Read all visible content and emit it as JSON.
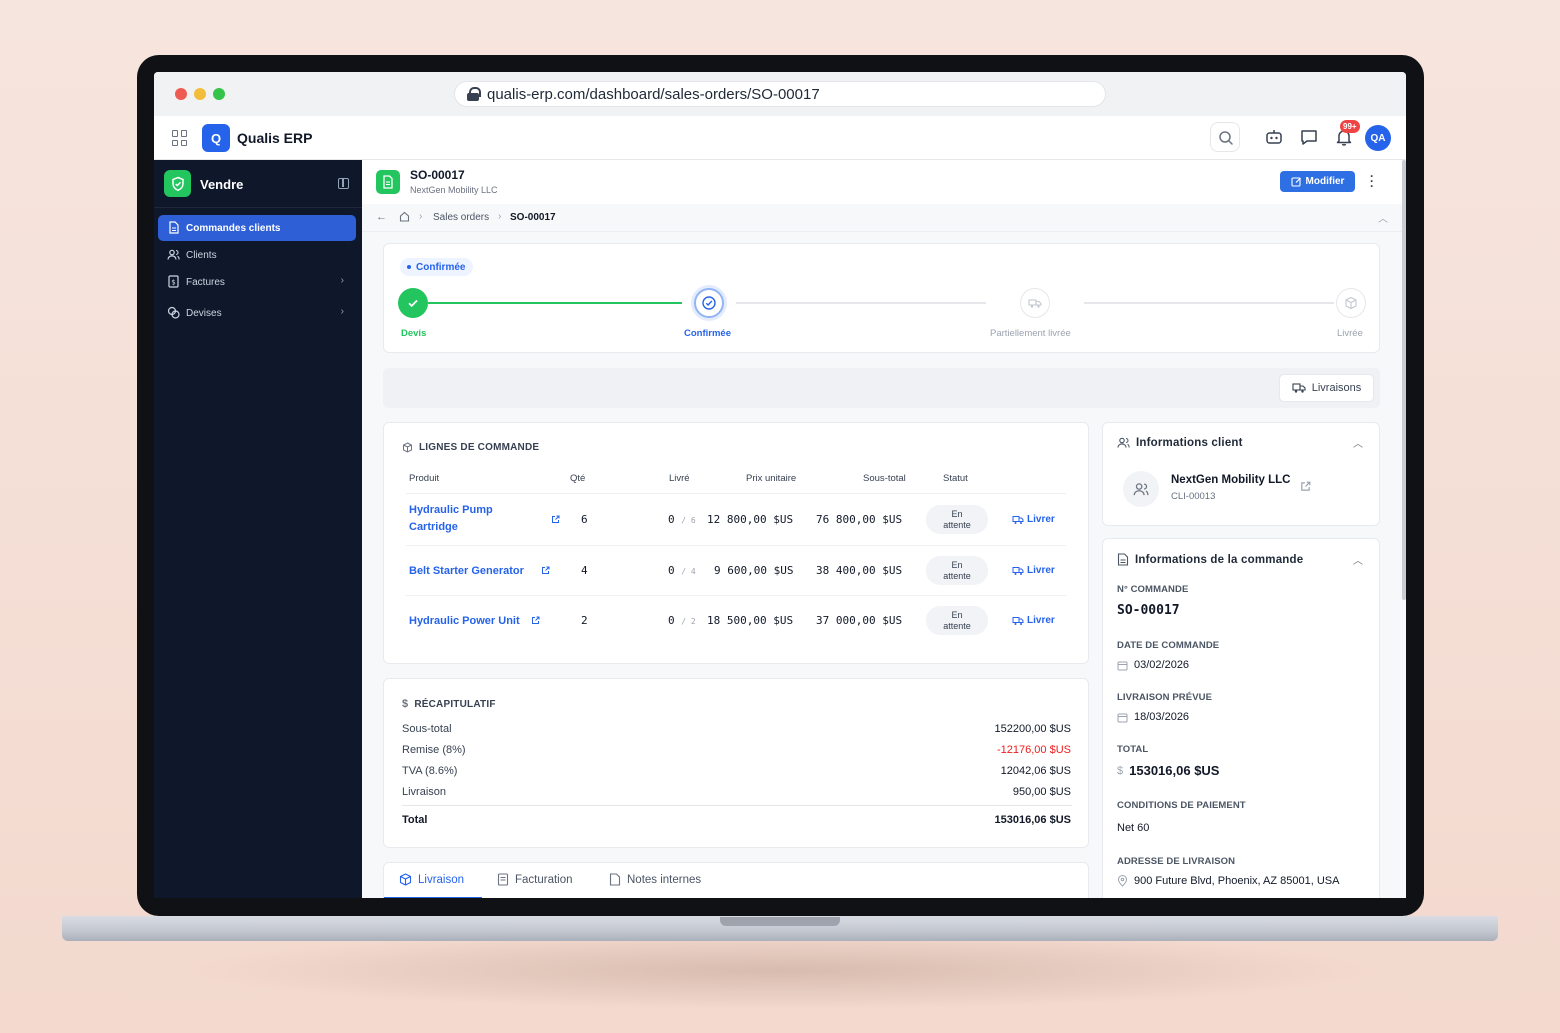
{
  "browser": {
    "url": "qualis-erp.com/dashboard/sales-orders/SO-00017"
  },
  "app": {
    "name": "Qualis ERP",
    "logo_letter": "Q",
    "notif_badge": "99+",
    "avatar_initials": "QA"
  },
  "sidebar": {
    "title": "Vendre",
    "items": [
      {
        "label": "Commandes clients",
        "active": true
      },
      {
        "label": "Clients"
      },
      {
        "label": "Factures"
      },
      {
        "label": "Devises"
      }
    ]
  },
  "order": {
    "id": "SO-00017",
    "customer": "NextGen Mobility LLC",
    "edit_label": "Modifier"
  },
  "breadcrumb": {
    "parent": "Sales orders",
    "current": "SO-00017"
  },
  "status": {
    "chip": "Confirmée",
    "steps": [
      {
        "label": "Devis",
        "state": "done"
      },
      {
        "label": "Confirmée",
        "state": "current"
      },
      {
        "label": "Partiellement livrée",
        "state": "pending"
      },
      {
        "label": "Livrée",
        "state": "pending"
      }
    ]
  },
  "deliveries_button": "Livraisons",
  "lines": {
    "title": "LIGNES DE COMMANDE",
    "headers": {
      "product": "Produit",
      "qty": "Qté",
      "delivered": "Livré",
      "unit_price": "Prix unitaire",
      "subtotal": "Sous-total",
      "status": "Statut"
    },
    "rows": [
      {
        "product": "Hydraulic Pump Cartridge",
        "qty": "6",
        "delivered": "0",
        "delivered_of": "/ 6",
        "unit_price": "12 800,00 $US",
        "subtotal": "76 800,00 $US",
        "status_1": "En",
        "status_2": "attente",
        "action": "Livrer"
      },
      {
        "product": "Belt Starter Generator",
        "qty": "4",
        "delivered": "0",
        "delivered_of": "/ 4",
        "unit_price": "9 600,00 $US",
        "subtotal": "38 400,00 $US",
        "status_1": "En",
        "status_2": "attente",
        "action": "Livrer"
      },
      {
        "product": "Hydraulic Power Unit",
        "qty": "2",
        "delivered": "0",
        "delivered_of": "/ 2",
        "unit_price": "18 500,00 $US",
        "subtotal": "37 000,00 $US",
        "status_1": "En",
        "status_2": "attente",
        "action": "Livrer"
      }
    ]
  },
  "summary": {
    "title": "RÉCAPITULATIF",
    "rows": [
      {
        "label": "Sous-total",
        "value": "152200,00 $US"
      },
      {
        "label": "Remise (8%)",
        "value": "-12176,00 $US"
      },
      {
        "label": "TVA (8.6%)",
        "value": "12042,06 $US"
      },
      {
        "label": "Livraison",
        "value": "950,00 $US"
      }
    ],
    "total_label": "Total",
    "total_value": "153016,06 $US",
    "negative_color": "#ef1c1c"
  },
  "tabs": [
    {
      "label": "Livraison",
      "active": true
    },
    {
      "label": "Facturation"
    },
    {
      "label": "Notes internes"
    }
  ],
  "client_info": {
    "title": "Informations client",
    "name": "NextGen Mobility LLC",
    "code": "CLI-00013"
  },
  "order_info": {
    "title": "Informations de la commande",
    "number_label": "N° COMMANDE",
    "number": "SO-00017",
    "date_label": "DATE DE COMMANDE",
    "date": "03/02/2026",
    "delivery_label": "LIVRAISON PRÉVUE",
    "delivery": "18/03/2026",
    "total_label": "TOTAL",
    "total": "153016,06 $US",
    "terms_label": "CONDITIONS DE PAIEMENT",
    "terms": "Net 60",
    "address_label": "ADRESSE DE LIVRAISON",
    "address": "900 Future Blvd, Phoenix, AZ 85001, USA"
  },
  "colors": {
    "accent": "#2563eb",
    "success": "#22c55e",
    "sidebar_bg": "#0f172a"
  }
}
